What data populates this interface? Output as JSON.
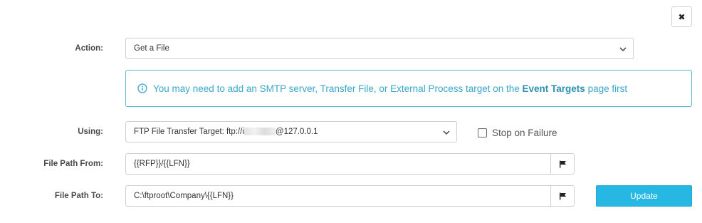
{
  "close_button": {
    "label": "✖"
  },
  "action": {
    "label": "Action:",
    "selected": "Get a File"
  },
  "alert": {
    "text_before": "You may need to add an SMTP server, Transfer File, or External Process target on the ",
    "link_text": "Event Targets",
    "text_after": " page first"
  },
  "using": {
    "label": "Using:",
    "selected_prefix": "FTP File Transfer Target: ftp://i",
    "selected_suffix": "@127.0.0.1"
  },
  "stop_on_failure": {
    "label": "Stop on Failure",
    "checked": false
  },
  "file_path_from": {
    "label": "File Path From:",
    "value": "{{RFP}}/{{LFN}}"
  },
  "file_path_to": {
    "label": "File Path To:",
    "value": "C:\\ftproot\\Company\\{{LFN}}"
  },
  "update_button": {
    "label": "Update"
  },
  "colors": {
    "accent": "#27b7e3",
    "alert_border": "#5bbad5",
    "alert_text": "#3aa7c8"
  }
}
